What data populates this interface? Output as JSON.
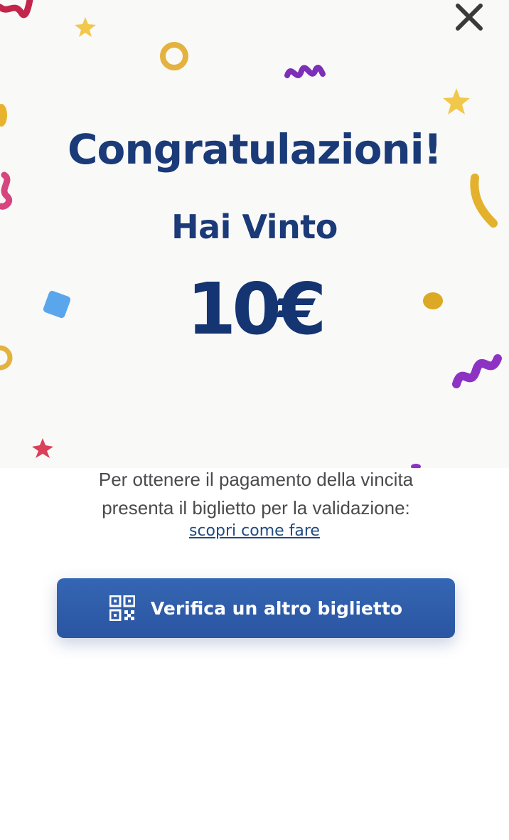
{
  "modal": {
    "close_icon": "close-icon",
    "title": "Congratulazioni!",
    "subtitle": "Hai Vinto",
    "amount": "10€",
    "info_line1": "Per ottenere il pagamento della vincita",
    "info_line2": "presenta il biglietto per la validazione:",
    "link_text": "scopri come fare",
    "cta_label": "Verifica un altro biglietto",
    "cta_icon": "qr-code-icon"
  },
  "colors": {
    "title": "#1a3a78",
    "button": "#2e5daa",
    "link": "#1f4a80",
    "hero_bg": "#f9f9f8"
  }
}
